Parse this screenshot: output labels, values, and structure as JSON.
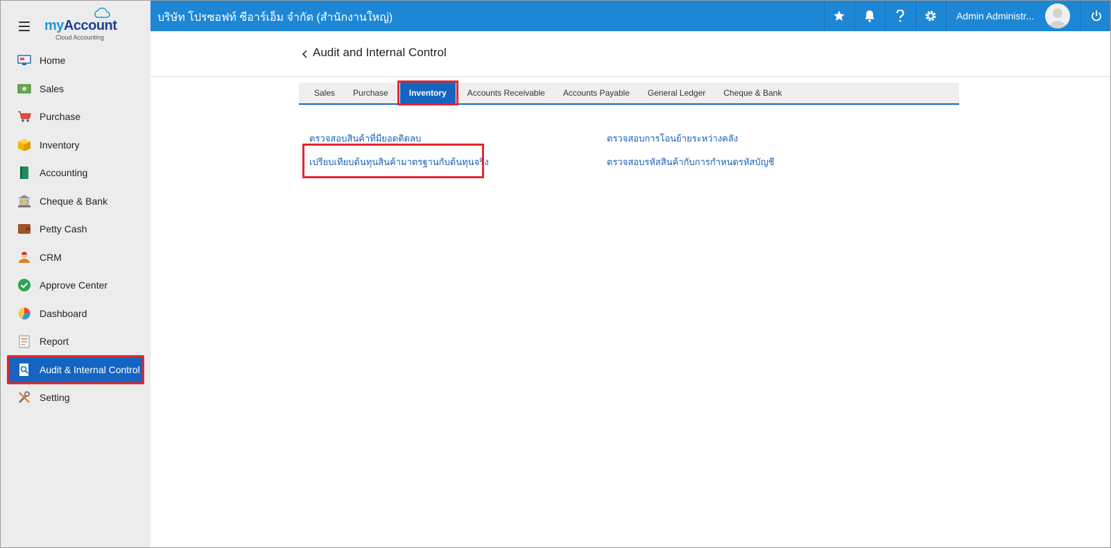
{
  "logo": {
    "brand_my": "my",
    "brand_account": "Account",
    "tagline": "Cloud Accounting"
  },
  "sidebar": {
    "items": [
      {
        "label": "Home",
        "icon": "home-icon"
      },
      {
        "label": "Sales",
        "icon": "money-icon"
      },
      {
        "label": "Purchase",
        "icon": "cart-icon"
      },
      {
        "label": "Inventory",
        "icon": "box-icon"
      },
      {
        "label": "Accounting",
        "icon": "book-icon"
      },
      {
        "label": "Cheque & Bank",
        "icon": "bank-icon"
      },
      {
        "label": "Petty Cash",
        "icon": "wallet-icon"
      },
      {
        "label": "CRM",
        "icon": "people-icon"
      },
      {
        "label": "Approve Center",
        "icon": "check-circle-icon"
      },
      {
        "label": "Dashboard",
        "icon": "pie-chart-icon"
      },
      {
        "label": "Report",
        "icon": "report-icon"
      },
      {
        "label": "Audit & Internal Control",
        "icon": "audit-icon",
        "active": true
      },
      {
        "label": "Setting",
        "icon": "tools-icon"
      }
    ]
  },
  "header": {
    "company": "บริษัท โปรซอฟท์ ซีอาร์เอ็ม จำกัด (สำนักงานใหญ่)",
    "user_name": "Admin Administr..."
  },
  "page": {
    "title": "Audit and Internal Control",
    "tabs": [
      {
        "label": "Sales"
      },
      {
        "label": "Purchase"
      },
      {
        "label": "Inventory",
        "active": true
      },
      {
        "label": "Accounts Receivable"
      },
      {
        "label": "Accounts Payable"
      },
      {
        "label": "General Ledger"
      },
      {
        "label": "Cheque & Bank"
      }
    ],
    "links": {
      "negative_stock": "ตรวจสอบสินค้าที่มียอดติดลบ",
      "warehouse_transfer": "ตรวจสอบการโอนย้ายระหว่างคลัง",
      "standard_vs_actual_cost": "เปรียบเทียบต้นทุนสินค้ามาตรฐานกับต้นทุนจริง",
      "product_code_account": "ตรวจสอบรหัสสินค้ากับการกำหนดรหัสบัญชี"
    }
  },
  "colors": {
    "topbar": "#1d87d6",
    "active": "#1565c0",
    "highlight": "#e3262d",
    "sidebar_bg": "#ececec",
    "link": "#1a5fb4"
  }
}
